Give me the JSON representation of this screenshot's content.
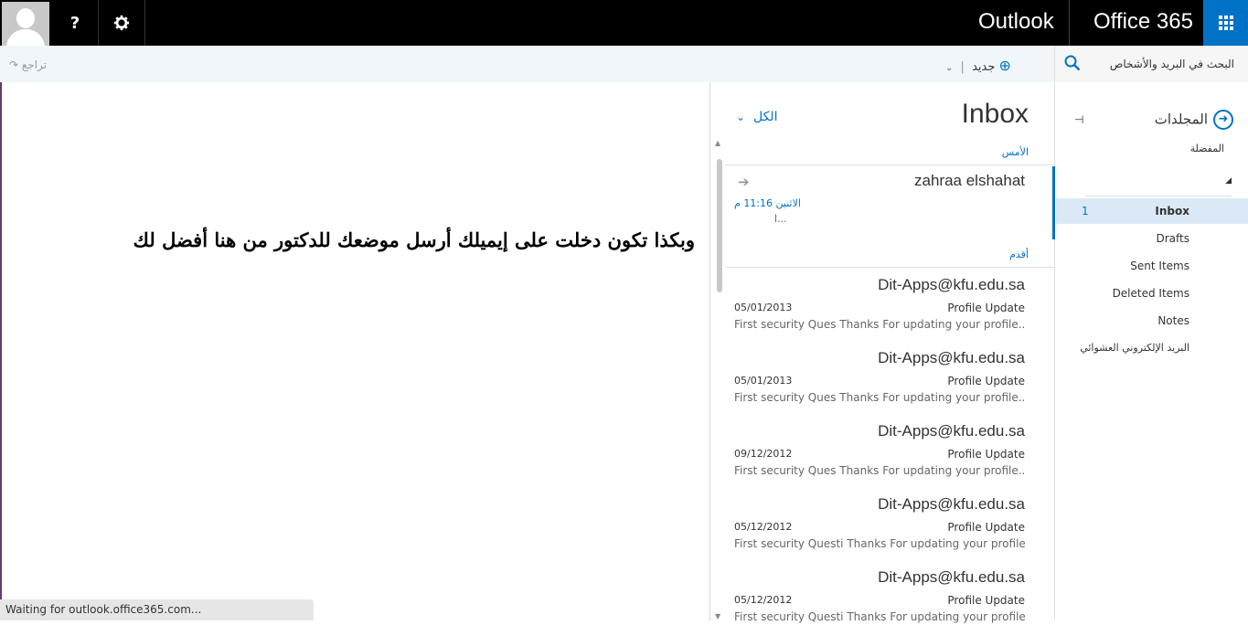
{
  "topbar": {
    "help_label": "?",
    "settings_icon": "gear-icon",
    "outlook_label": "Outlook",
    "office_label": "Office 365",
    "app_launcher_icon": "grid-icon",
    "accent": "#0072c6"
  },
  "toolbar": {
    "redo_label": "تراجع",
    "new_label": "جديد",
    "search_label": "البحث في البريد والأشخاص"
  },
  "reading": {
    "instruction": "وبكذا تكون دخلت على إيميلك أرسل موضعك للدكتور من هنا أفضل لك"
  },
  "status": {
    "text": "Waiting for outlook.office365.com..."
  },
  "list": {
    "title": "Inbox",
    "filter_label": "الكل",
    "group_yesterday": "الأمس",
    "group_older": "أقدم",
    "messages": [
      {
        "sender": "zahraa elshahat",
        "date": "الاثنين 11:16 م",
        "subject": "",
        "preview": "ا..."
      },
      {
        "sender": "Dit-Apps@kfu.edu.sa",
        "date": "05/01/2013",
        "subject": "Profile Update",
        "preview": "First security Ques    Thanks For updating your profile..."
      },
      {
        "sender": "Dit-Apps@kfu.edu.sa",
        "date": "05/01/2013",
        "subject": "Profile Update",
        "preview": "First security Ques    Thanks For updating your profile..."
      },
      {
        "sender": "Dit-Apps@kfu.edu.sa",
        "date": "09/12/2012",
        "subject": "Profile Update",
        "preview": "First security Ques    Thanks For updating your profile..."
      },
      {
        "sender": "Dit-Apps@kfu.edu.sa",
        "date": "05/12/2012",
        "subject": "Profile Update",
        "preview": "First security Questi    Thanks For updating your profile..."
      },
      {
        "sender": "Dit-Apps@kfu.edu.sa",
        "date": "05/12/2012",
        "subject": "Profile Update",
        "preview": "First security Questi    Thanks For updating your profile..."
      }
    ]
  },
  "folders": {
    "header": "المجلدات",
    "favorites": "المفضلة",
    "items": [
      {
        "label": "Inbox",
        "count": "1"
      },
      {
        "label": "Drafts",
        "count": ""
      },
      {
        "label": "Sent Items",
        "count": ""
      },
      {
        "label": "Deleted Items",
        "count": ""
      },
      {
        "label": "Notes",
        "count": ""
      },
      {
        "label": "البريد الإلكتروني العشوائي",
        "count": ""
      }
    ]
  }
}
